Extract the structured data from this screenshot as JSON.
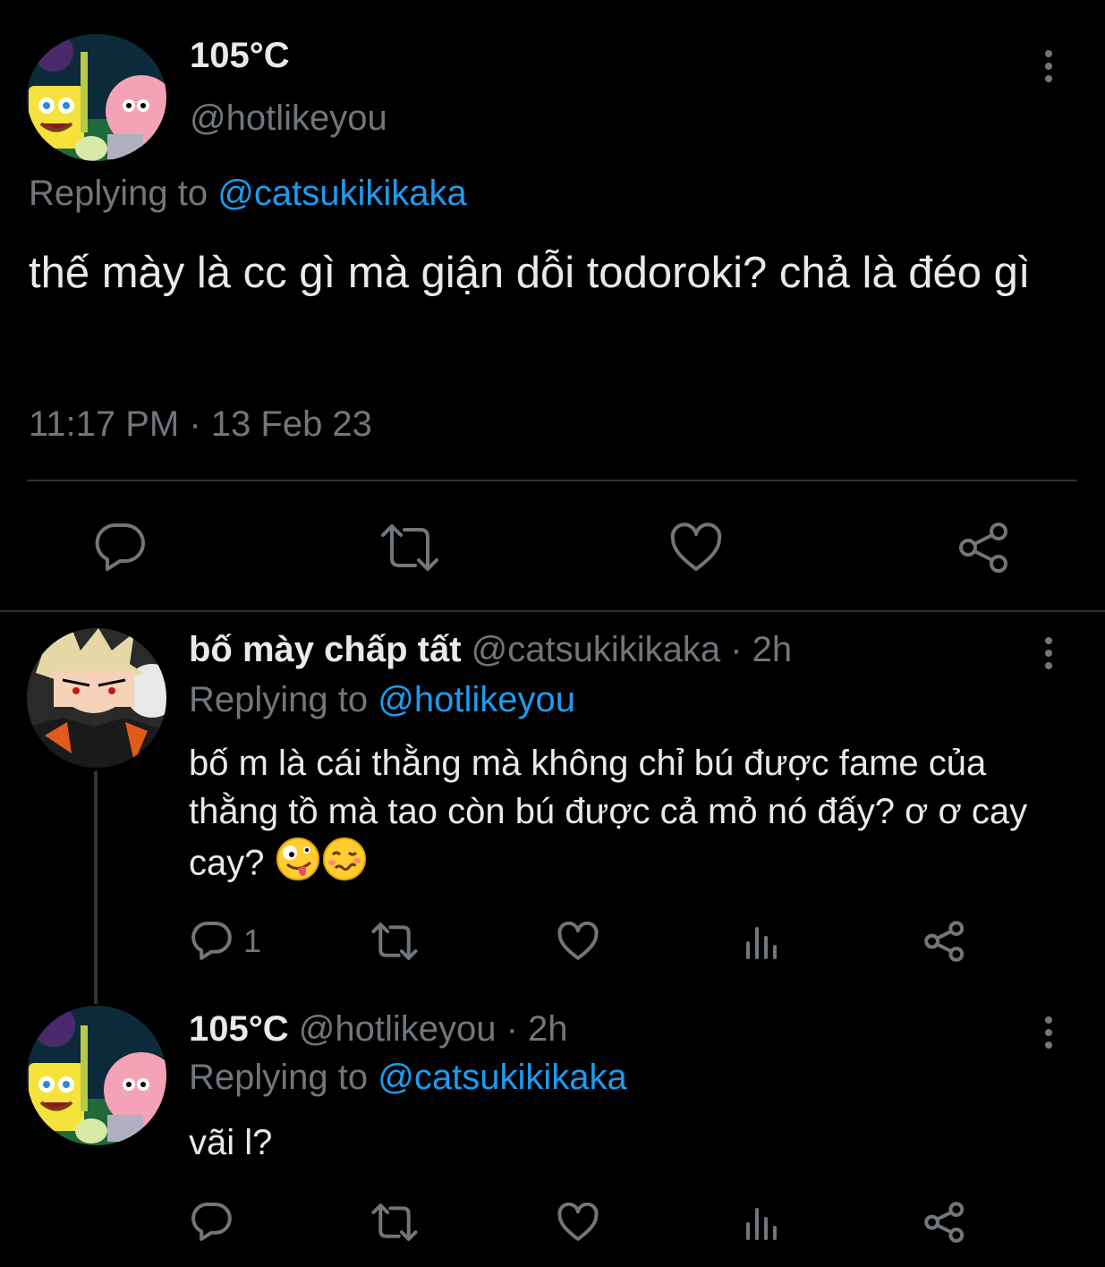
{
  "main_tweet": {
    "display_name": "105°C",
    "handle": "@hotlikeyou",
    "replying_prefix": "Replying to",
    "replying_handle": "@catsukikikaka",
    "text": "thế mày là cc gì mà giận dỗi todoroki? chả là đéo gì",
    "timestamp": "11:17 PM · 13 Feb 23",
    "actions": [
      "reply-icon",
      "retweet-icon",
      "like-icon",
      "share-icon"
    ]
  },
  "replies": [
    {
      "display_name": "bố mày chấp tất",
      "handle": "@catsukikikaka",
      "age": "· 2h",
      "replying_prefix": "Replying to",
      "replying_handle": "@hotlikeyou",
      "text": "bố m là cái thằng mà không chỉ bú được fame của thằng tồ mà tao còn bú được cả mỏ nó đấy? ơ ơ cay cay?",
      "emojis": [
        "zany-face",
        "woozy-face"
      ],
      "reply_count": "1",
      "actions": [
        "reply-icon",
        "retweet-icon",
        "like-icon",
        "views-icon",
        "share-icon"
      ]
    },
    {
      "display_name": "105°C",
      "handle": "@hotlikeyou",
      "age": "· 2h",
      "replying_prefix": "Replying to",
      "replying_handle": "@catsukikikaka",
      "text": "vãi l?",
      "actions": [
        "reply-icon",
        "retweet-icon",
        "like-icon",
        "views-icon",
        "share-icon"
      ]
    }
  ],
  "colors": {
    "background": "#000000",
    "text": "#e7e9ea",
    "secondary": "#71767b",
    "accent": "#1d9bf0",
    "divider": "#2f3336"
  }
}
